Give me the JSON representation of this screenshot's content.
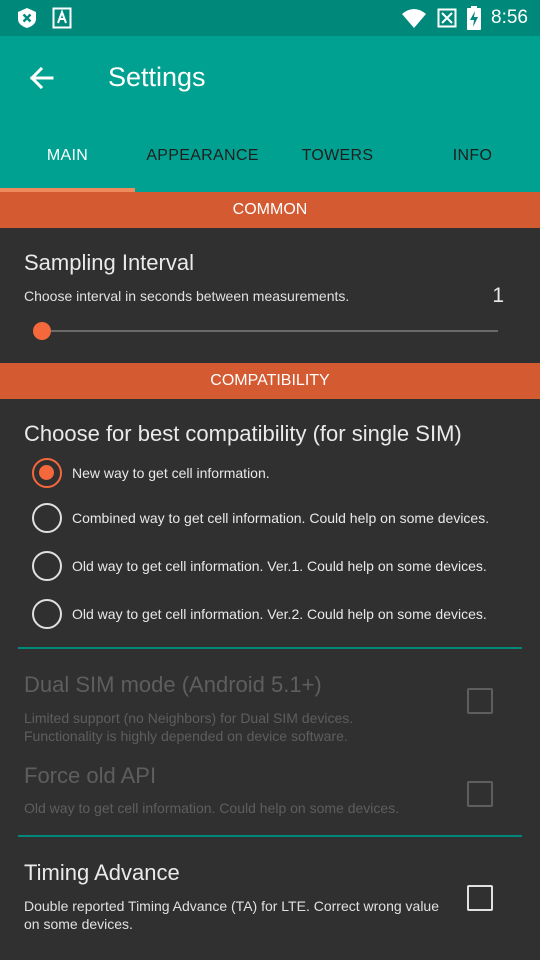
{
  "status_bar": {
    "time": "8:56",
    "left_icons": [
      "close-badge-icon",
      "text-a-icon"
    ],
    "right_icons": [
      "wifi-icon",
      "no-signal-icon",
      "battery-charging-icon"
    ]
  },
  "app_bar": {
    "title": "Settings",
    "back_icon": "arrow-left-icon"
  },
  "tabs": [
    {
      "label": "MAIN",
      "active": true
    },
    {
      "label": "APPEARANCE",
      "active": false
    },
    {
      "label": "TOWERS",
      "active": false
    },
    {
      "label": "INFO",
      "active": false
    }
  ],
  "sections": {
    "common": "COMMON",
    "compatibility": "COMPATIBILITY"
  },
  "sampling": {
    "title": "Sampling Interval",
    "summary": "Choose interval in seconds between measurements.",
    "value": "1"
  },
  "compat": {
    "title": "Choose for best compatibility (for single SIM)",
    "options": [
      {
        "label": "New way to get cell information.",
        "checked": true
      },
      {
        "label": "Combined way to get cell information. Could help on some devices.",
        "checked": false
      },
      {
        "label": "Old way to get cell information. Ver.1. Could help on some devices.",
        "checked": false
      },
      {
        "label": "Old way to get cell information. Ver.2. Could help on some devices.",
        "checked": false
      }
    ]
  },
  "dual_sim": {
    "title": "Dual SIM mode (Android 5.1+)",
    "summary": "Limited support (no Neighbors) for Dual SIM devices. Functionality is highly depended on device software.",
    "checked": false,
    "enabled": false
  },
  "force_old_api": {
    "title": "Force old API",
    "summary": "Old way to get cell information. Could help on some devices.",
    "checked": false,
    "enabled": false
  },
  "timing_advance": {
    "title": "Timing Advance",
    "summary": "Double reported Timing Advance (TA) for LTE. Correct wrong value on some devices.",
    "checked": false,
    "enabled": true
  },
  "colors": {
    "status_bar": "#00897b",
    "app_bar": "#00a190",
    "section_header": "#d45a32",
    "accent": "#f4683c",
    "background": "#303030"
  }
}
